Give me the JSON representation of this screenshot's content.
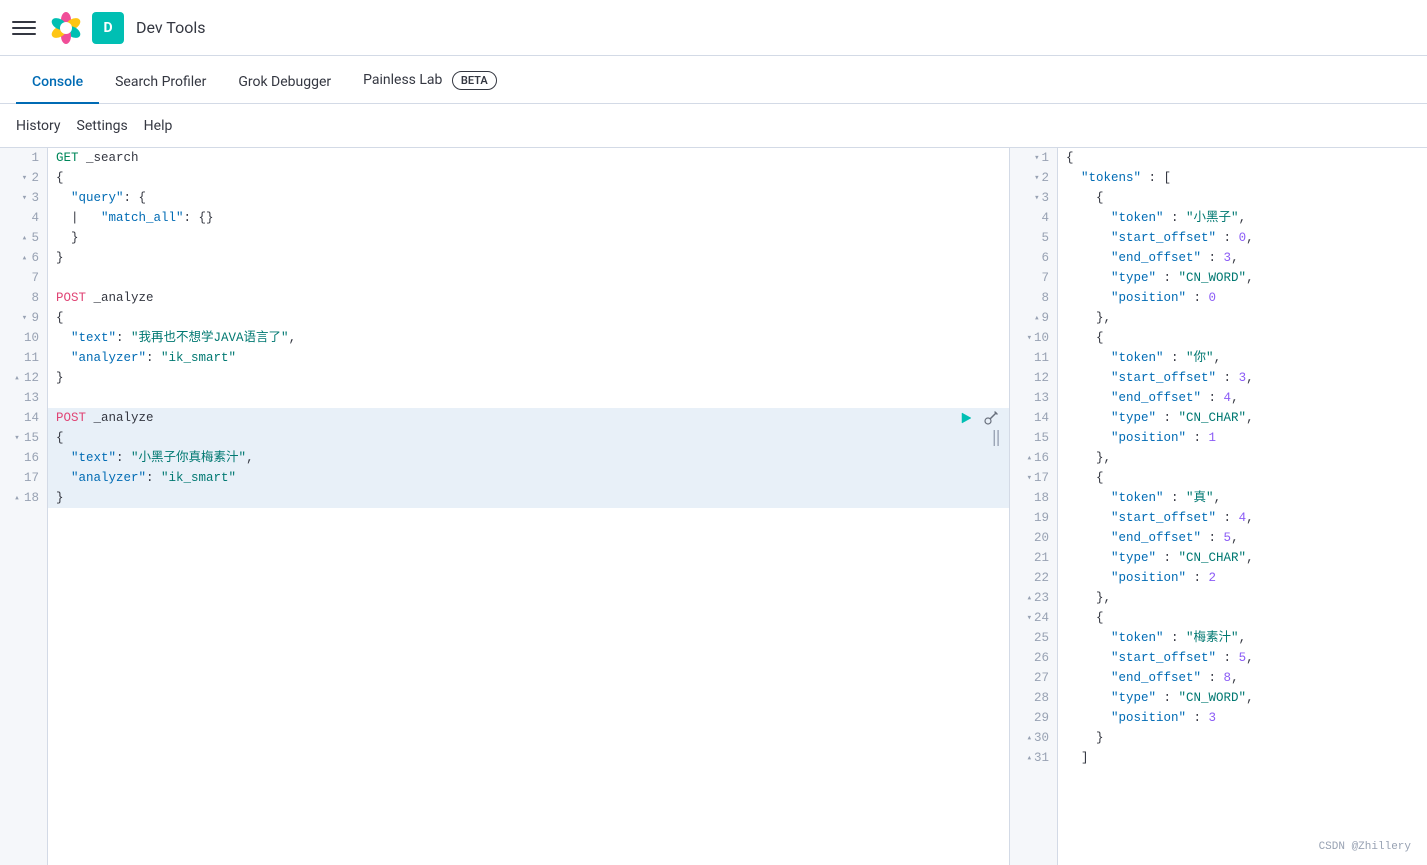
{
  "topbar": {
    "app_title": "Dev Tools",
    "user_initial": "D"
  },
  "tabs": [
    {
      "id": "console",
      "label": "Console",
      "active": true
    },
    {
      "id": "search-profiler",
      "label": "Search Profiler",
      "active": false
    },
    {
      "id": "grok-debugger",
      "label": "Grok Debugger",
      "active": false
    },
    {
      "id": "painless-lab",
      "label": "Painless Lab",
      "active": false,
      "badge": "BETA"
    }
  ],
  "toolbar": {
    "history": "History",
    "settings": "Settings",
    "help": "Help"
  },
  "editor": {
    "lines": [
      {
        "num": 1,
        "fold": false,
        "content": "GET _search",
        "type": "method-path"
      },
      {
        "num": 2,
        "fold": true,
        "content": "{",
        "type": "bracket"
      },
      {
        "num": 3,
        "fold": true,
        "content": "  \"query\": {",
        "type": "key-obj"
      },
      {
        "num": 4,
        "fold": false,
        "content": "  |   \"match_all\": {}",
        "type": "key-obj"
      },
      {
        "num": 5,
        "fold": true,
        "content": "  }",
        "type": "bracket"
      },
      {
        "num": 6,
        "fold": true,
        "content": "}",
        "type": "bracket"
      },
      {
        "num": 7,
        "fold": false,
        "content": "",
        "type": "plain"
      },
      {
        "num": 8,
        "fold": false,
        "content": "POST _analyze",
        "type": "method-path"
      },
      {
        "num": 9,
        "fold": true,
        "content": "{",
        "type": "bracket"
      },
      {
        "num": 10,
        "fold": false,
        "content": "  \"text\": \"我再也不想学JAVA语言了\",",
        "type": "key-str"
      },
      {
        "num": 11,
        "fold": false,
        "content": "  \"analyzer\": \"ik_smart\"",
        "type": "key-str"
      },
      {
        "num": 12,
        "fold": true,
        "content": "}",
        "type": "bracket"
      },
      {
        "num": 13,
        "fold": false,
        "content": "",
        "type": "plain"
      },
      {
        "num": 14,
        "fold": false,
        "content": "POST _analyze",
        "type": "method-path",
        "highlighted": true
      },
      {
        "num": 15,
        "fold": true,
        "content": "{",
        "type": "bracket",
        "highlighted": true
      },
      {
        "num": 16,
        "fold": false,
        "content": "  \"text\": \"小黑子你真梅素汁\",",
        "type": "key-str",
        "highlighted": true
      },
      {
        "num": 17,
        "fold": false,
        "content": "  \"analyzer\": \"ik_smart\"",
        "type": "key-str",
        "highlighted": true
      },
      {
        "num": 18,
        "fold": true,
        "content": "}",
        "type": "bracket",
        "highlighted": true
      }
    ]
  },
  "output": {
    "lines": [
      {
        "num": 1,
        "fold": false,
        "text": "{"
      },
      {
        "num": 2,
        "fold": true,
        "text": "  \"tokens\" : ["
      },
      {
        "num": 3,
        "fold": true,
        "text": "    {"
      },
      {
        "num": 4,
        "fold": false,
        "text": "      \"token\" : \"小黑子\","
      },
      {
        "num": 5,
        "fold": false,
        "text": "      \"start_offset\" : 0,"
      },
      {
        "num": 6,
        "fold": false,
        "text": "      \"end_offset\" : 3,"
      },
      {
        "num": 7,
        "fold": false,
        "text": "      \"type\" : \"CN_WORD\","
      },
      {
        "num": 8,
        "fold": false,
        "text": "      \"position\" : 0"
      },
      {
        "num": 9,
        "fold": true,
        "text": "    },"
      },
      {
        "num": 10,
        "fold": true,
        "text": "    {"
      },
      {
        "num": 11,
        "fold": false,
        "text": "      \"token\" : \"你\","
      },
      {
        "num": 12,
        "fold": false,
        "text": "      \"start_offset\" : 3,"
      },
      {
        "num": 13,
        "fold": false,
        "text": "      \"end_offset\" : 4,"
      },
      {
        "num": 14,
        "fold": false,
        "text": "      \"type\" : \"CN_CHAR\","
      },
      {
        "num": 15,
        "fold": false,
        "text": "      \"position\" : 1"
      },
      {
        "num": 16,
        "fold": true,
        "text": "    },"
      },
      {
        "num": 17,
        "fold": true,
        "text": "    {"
      },
      {
        "num": 18,
        "fold": false,
        "text": "      \"token\" : \"真\","
      },
      {
        "num": 19,
        "fold": false,
        "text": "      \"start_offset\" : 4,"
      },
      {
        "num": 20,
        "fold": false,
        "text": "      \"end_offset\" : 5,"
      },
      {
        "num": 21,
        "fold": false,
        "text": "      \"type\" : \"CN_CHAR\","
      },
      {
        "num": 22,
        "fold": false,
        "text": "      \"position\" : 2"
      },
      {
        "num": 23,
        "fold": true,
        "text": "    },"
      },
      {
        "num": 24,
        "fold": true,
        "text": "    {"
      },
      {
        "num": 25,
        "fold": false,
        "text": "      \"token\" : \"梅素汁\","
      },
      {
        "num": 26,
        "fold": false,
        "text": "      \"start_offset\" : 5,"
      },
      {
        "num": 27,
        "fold": false,
        "text": "      \"end_offset\" : 8,"
      },
      {
        "num": 28,
        "fold": false,
        "text": "      \"type\" : \"CN_WORD\","
      },
      {
        "num": 29,
        "fold": false,
        "text": "      \"position\" : 3"
      },
      {
        "num": 30,
        "fold": true,
        "text": "    }"
      },
      {
        "num": 31,
        "fold": true,
        "text": "  ]"
      }
    ]
  },
  "watermark": "CSDN @Zhillery"
}
